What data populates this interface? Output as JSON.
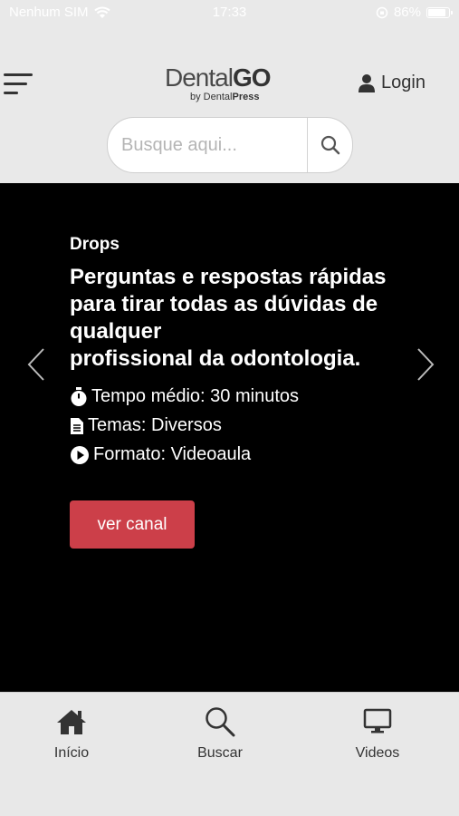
{
  "status_bar": {
    "carrier": "Nenhum SIM",
    "time": "17:33",
    "battery_percent": "86%",
    "battery_level": 0.86
  },
  "header": {
    "logo_main": "Dental",
    "logo_bold": "GO",
    "logo_sub_prefix": "by Dental",
    "logo_sub_bold": "Press",
    "login_label": "Login"
  },
  "search": {
    "placeholder": "Busque aqui..."
  },
  "hero": {
    "category": "Drops",
    "headline_lines": [
      "Perguntas e respostas rápidas",
      "para tirar todas as dúvidas de",
      "qualquer",
      "profissional da odontologia."
    ],
    "time": "Tempo médio: 30 minutos",
    "topics": "Temas: Diversos",
    "format": "Formato: Videoaula",
    "cta": "ver canal"
  },
  "tabbar": {
    "items": [
      {
        "label": "Início",
        "icon": "home-icon"
      },
      {
        "label": "Buscar",
        "icon": "search-icon"
      },
      {
        "label": "Videos",
        "icon": "monitor-icon"
      }
    ]
  },
  "colors": {
    "accent": "#cc3f49",
    "hero_bg": "#000000",
    "page_bg": "#e9e9e9"
  }
}
